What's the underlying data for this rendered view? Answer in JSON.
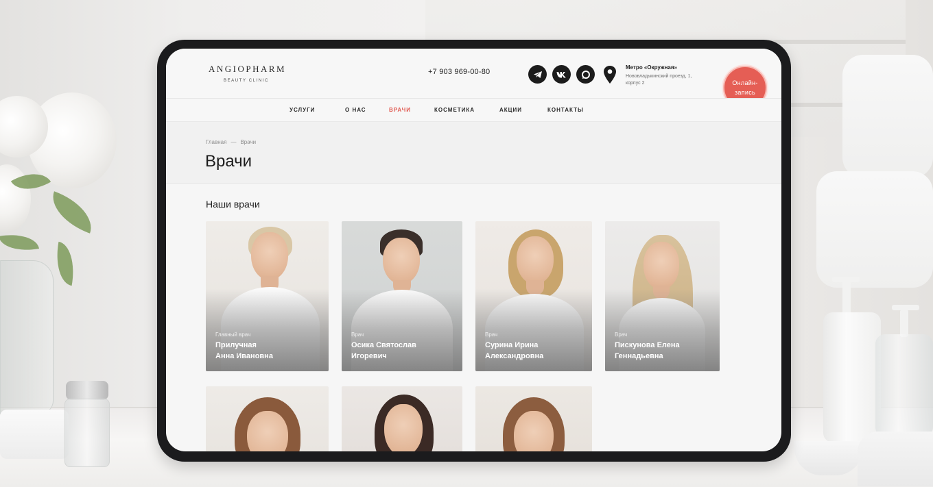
{
  "header": {
    "logo_main": "ANGIOPHARM",
    "logo_sub": "BEAUTY CLINIC",
    "phone": "+7 903 969-00-80",
    "socials": [
      {
        "icon": "telegram-icon"
      },
      {
        "icon": "vk-icon"
      },
      {
        "icon": "max-chat-icon"
      }
    ],
    "address_title": "Метро «Окружная»",
    "address_line1": "Нововладыкинский проезд, 1,",
    "address_line2": "корпус 2",
    "online_line1": "Онлайн-",
    "online_line2": "запись"
  },
  "nav": {
    "items": [
      {
        "label": "УСЛУГИ"
      },
      {
        "label": "О НАС"
      },
      {
        "label": "ВРАЧИ"
      },
      {
        "label": "КОСМЕТИКА"
      },
      {
        "label": "АКЦИИ"
      },
      {
        "label": "КОНТАКТЫ"
      }
    ],
    "active": "ВРАЧИ"
  },
  "breadcrumb": {
    "home": "Главная",
    "separator": "—",
    "current": "Врачи"
  },
  "page_title": "Врачи",
  "section_title": "Наши врачи",
  "doctors": [
    {
      "role": "Главный врач",
      "name_line1": "Прилучная",
      "name_line2": "Анна Ивановна"
    },
    {
      "role": "Врач",
      "name_line1": "Осика Святослав",
      "name_line2": "Игоревич"
    },
    {
      "role": "Врач",
      "name_line1": "Сурина Ирина",
      "name_line2": "Александровна"
    },
    {
      "role": "Врач",
      "name_line1": "Пискунова Елена",
      "name_line2": "Геннадьевна"
    }
  ],
  "colors": {
    "accent": "#e55e55",
    "text": "#1d1d1d",
    "muted": "#8d8d8d",
    "tablet_frame": "#1b1b1d"
  }
}
